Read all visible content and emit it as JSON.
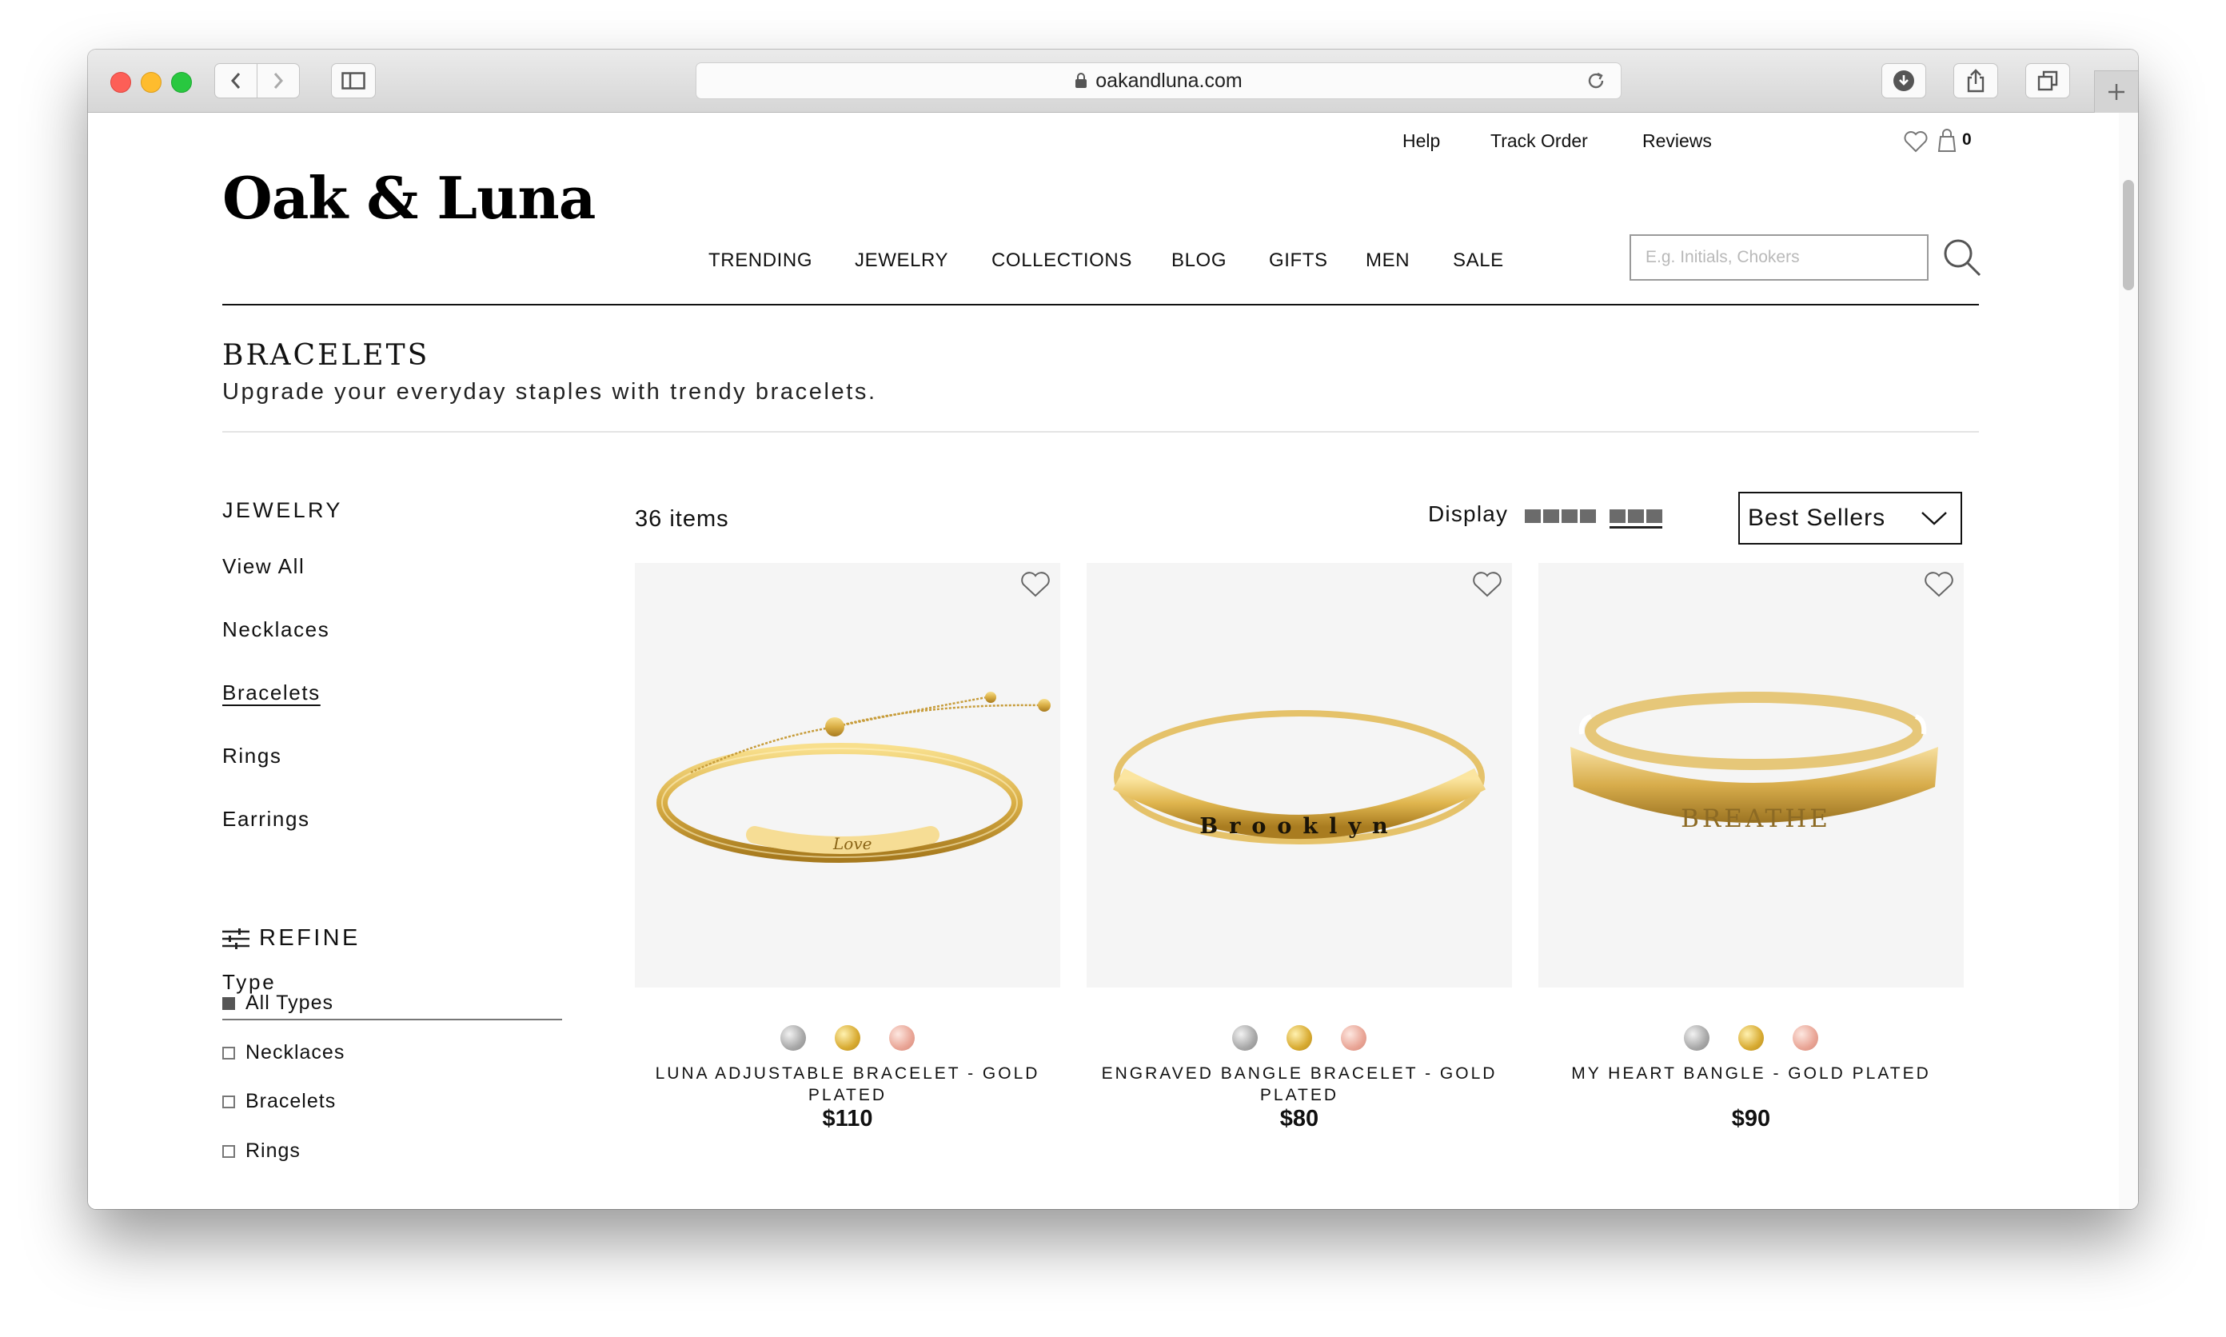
{
  "browser": {
    "url": "oakandluna.com"
  },
  "site": {
    "logo": "Oak & Luna",
    "util_links": [
      "Help",
      "Track Order",
      "Reviews"
    ],
    "cart_count": "0",
    "nav": [
      "TRENDING",
      "JEWELRY",
      "COLLECTIONS",
      "BLOG",
      "GIFTS",
      "MEN",
      "SALE"
    ],
    "search_placeholder": "E.g. Initials, Chokers"
  },
  "category": {
    "title": "BRACELETS",
    "subtitle": "Upgrade your everyday staples with trendy bracelets."
  },
  "sidebar": {
    "heading": "JEWELRY",
    "links": [
      "View All",
      "Necklaces",
      "Bracelets",
      "Rings",
      "Earrings"
    ],
    "active_link": "Bracelets",
    "refine_label": "REFINE",
    "type_label": "Type",
    "filters": [
      {
        "label": "All Types",
        "checked": true
      },
      {
        "label": "Necklaces",
        "checked": false
      },
      {
        "label": "Bracelets",
        "checked": false
      },
      {
        "label": "Rings",
        "checked": false
      }
    ]
  },
  "toolbar": {
    "item_count": "36 items",
    "display_label": "Display",
    "sort_value": "Best Sellers"
  },
  "products": [
    {
      "name": "LUNA ADJUSTABLE BRACELET - GOLD PLATED",
      "price": "$110",
      "engraving": "Love",
      "swatches": [
        "silver",
        "gold",
        "rose"
      ]
    },
    {
      "name": "ENGRAVED BANGLE BRACELET - GOLD PLATED",
      "price": "$80",
      "engraving": "Brooklyn",
      "swatches": [
        "silver",
        "gold",
        "rose"
      ]
    },
    {
      "name": "MY HEART BANGLE - GOLD PLATED",
      "price": "$90",
      "engraving": "BREATHE",
      "swatches": [
        "silver",
        "gold",
        "rose"
      ]
    }
  ],
  "colors": {
    "gold": "#d9ae45",
    "silver": "#a8a8a8",
    "rose": "#e9a596"
  }
}
